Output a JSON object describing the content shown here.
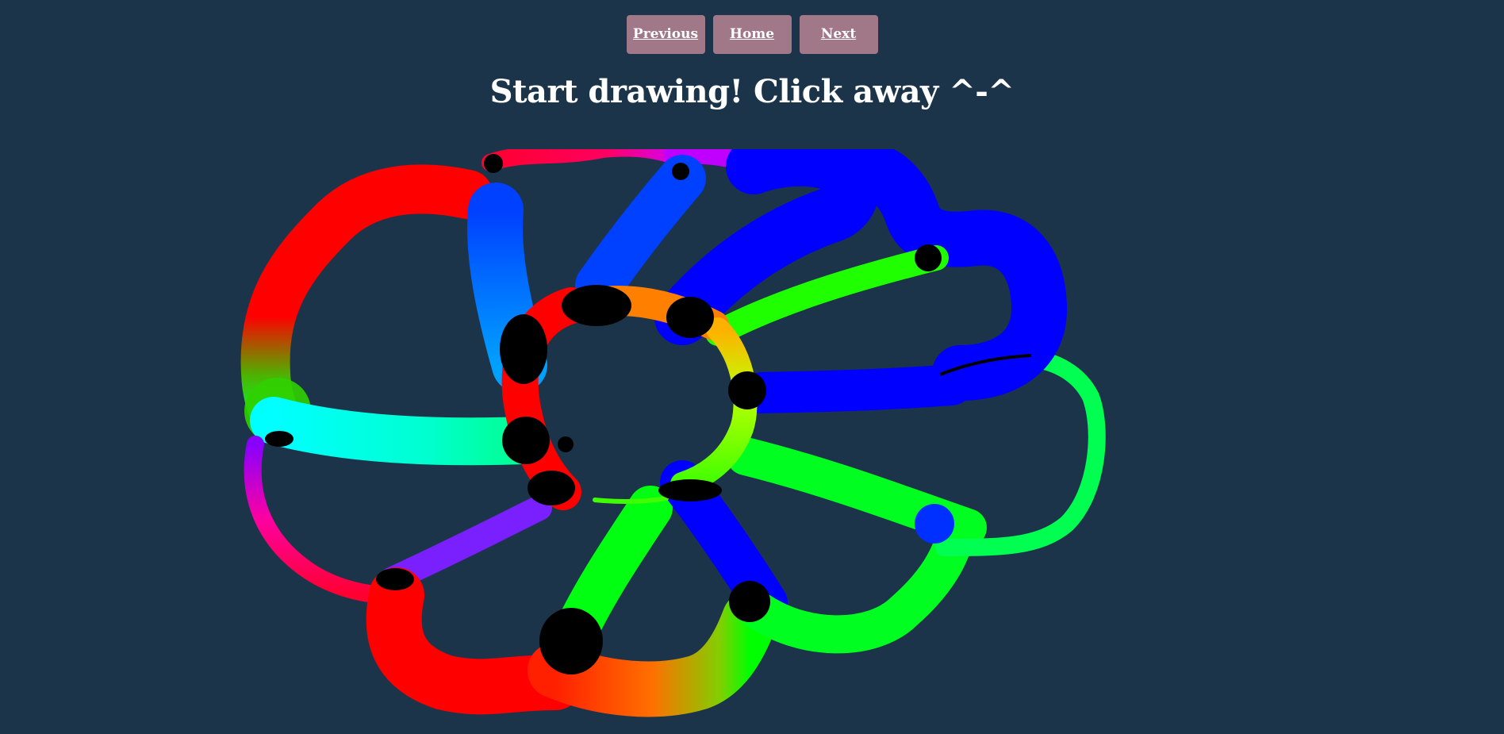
{
  "nav": {
    "previous_label": "Previous",
    "home_label": "Home",
    "next_label": "Next"
  },
  "heading": "Start drawing! Click away ^-^",
  "colors": {
    "background": "#1b344a",
    "button": "#a07888",
    "button_text": "#ffffff",
    "heading_text": "#ffffff"
  }
}
